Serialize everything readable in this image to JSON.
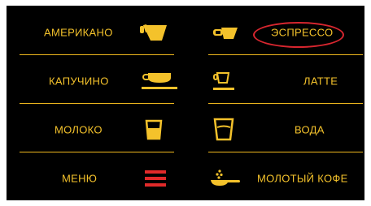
{
  "colors": {
    "accent": "#f4c22b",
    "divider": "#f0b81e",
    "highlight": "#d8262f",
    "menu_icon": "#e12a2a",
    "background": "#000000"
  },
  "drinks": {
    "americano": {
      "label": "АМЕРИКАНО",
      "icon": "americano-cup-icon"
    },
    "espresso": {
      "label": "ЭСПРЕССО",
      "icon": "espresso-cup-icon",
      "highlighted": true
    },
    "cappuccino": {
      "label": "КАПУЧИНО",
      "icon": "cappuccino-cup-icon"
    },
    "latte": {
      "label": "ЛАТТЕ",
      "icon": "latte-glass-icon"
    },
    "milk": {
      "label": "МОЛОКО",
      "icon": "milk-glass-icon"
    },
    "water": {
      "label": "ВОДА",
      "icon": "water-glass-icon"
    },
    "menu": {
      "label": "МЕНЮ",
      "icon": "hamburger-menu-icon"
    },
    "ground_coffee": {
      "label": "МОЛОТЫЙ КОФЕ",
      "icon": "coffee-scoop-icon"
    }
  }
}
